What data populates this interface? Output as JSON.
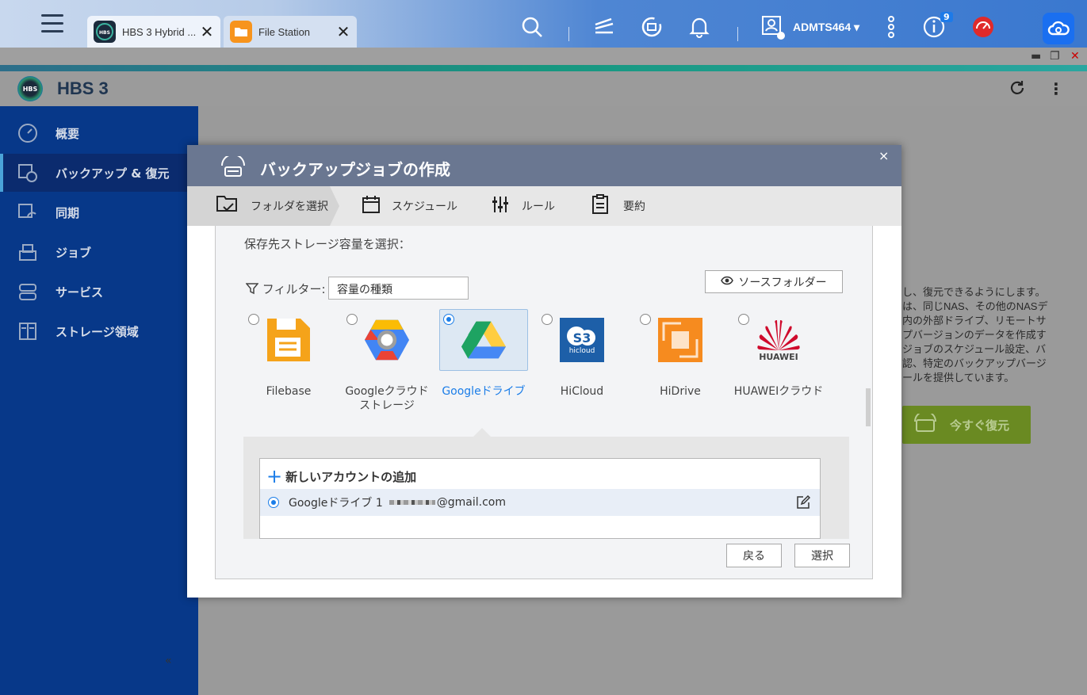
{
  "topbar": {
    "tabs": [
      {
        "label": "HBS 3 Hybrid ...",
        "icon": "hbs-app-icon"
      },
      {
        "label": "File Station",
        "icon": "folder-app-icon"
      }
    ],
    "username": "ADMTS464 ▾",
    "notification_count": "9"
  },
  "app": {
    "title": "HBS 3"
  },
  "sidebar": {
    "items": [
      {
        "label": "概要",
        "icon": "dashboard-icon"
      },
      {
        "label": "バックアップ & 復元",
        "icon": "backup-restore-icon"
      },
      {
        "label": "同期",
        "icon": "sync-icon"
      },
      {
        "label": "ジョブ",
        "icon": "job-icon"
      },
      {
        "label": "サービス",
        "icon": "service-icon"
      },
      {
        "label": "ストレージ領域",
        "icon": "storage-icon"
      }
    ],
    "collapse": "«"
  },
  "background": {
    "description_lines": [
      "し、復元できるようにします。",
      "は、同じNAS、その他のNASデ",
      "内の外部ドライブ、リモートサ",
      "プバージョンのデータを作成す",
      "ジョブのスケジュール設定、バ",
      "認、特定のバックアップバージ",
      "ールを提供しています。"
    ],
    "restore_now_label": "今すぐ復元"
  },
  "modal": {
    "title": "バックアップジョブの作成",
    "close": "×",
    "steps": [
      {
        "label": "フォルダを選択",
        "icon": "folder-check-icon"
      },
      {
        "label": "スケジュール",
        "icon": "calendar-icon"
      },
      {
        "label": "ルール",
        "icon": "sliders-icon"
      },
      {
        "label": "要約",
        "icon": "clipboard-icon"
      }
    ],
    "section_label": "保存先ストレージ容量を選択：",
    "filter_label": "フィルター:",
    "filter_value": "容量の種類",
    "source_folder_label": "ソースフォルダー",
    "providers": [
      {
        "name": "Filebase",
        "selected": false
      },
      {
        "name": "Googleクラウド\nストレージ",
        "selected": false
      },
      {
        "name": "Googleドライブ",
        "selected": true
      },
      {
        "name": "HiCloud",
        "selected": false
      },
      {
        "name": "HiDrive",
        "selected": false
      },
      {
        "name": "HUAWEIクラウド",
        "selected": false
      }
    ],
    "hicloud_logo_text": "hicloud",
    "huawei_logo_text": "HUAWEI",
    "add_account_label": "新しいアカウントの追加",
    "accounts": [
      {
        "name": "Googleドライブ 1",
        "email": "@gmail.com"
      }
    ],
    "back_label": "戻る",
    "select_label": "選択"
  },
  "colors": {
    "sidebar_bg": "#073889",
    "accent_blue": "#1b7de8",
    "modal_header": "#6a7791",
    "restore_green": "#6a8a22"
  }
}
